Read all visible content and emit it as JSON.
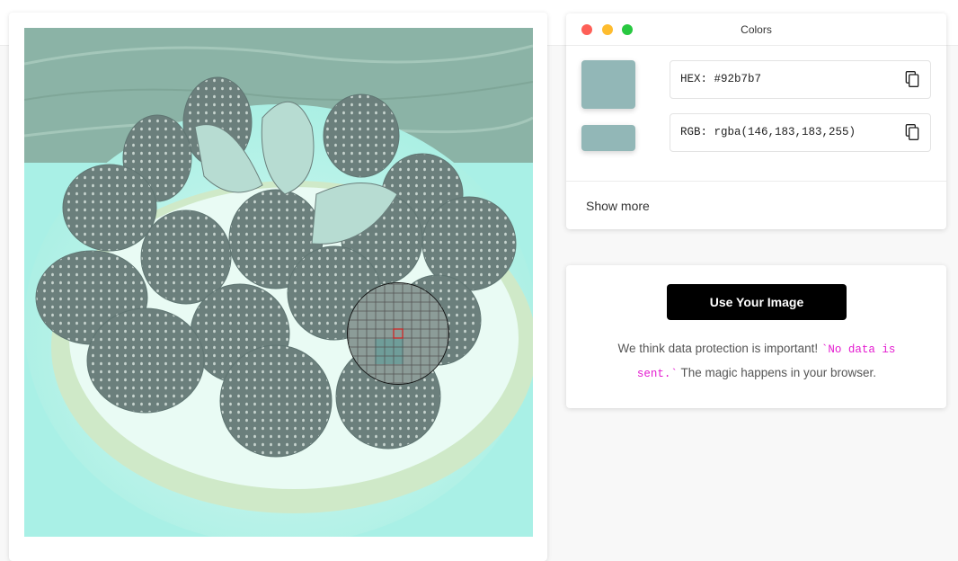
{
  "colors_panel": {
    "title": "Colors",
    "swatch_color": "#92b7b7",
    "hex_text": "HEX: #92b7b7",
    "rgb_text": "RGB: rgba(146,183,183,255)",
    "copy_icon": "copy-icon",
    "show_more_label": "Show more",
    "window_dots": [
      "#fe5f57",
      "#febc2e",
      "#28c840"
    ]
  },
  "upload_panel": {
    "button_label": "Use Your Image",
    "note_prefix": "We think data protection is important! ",
    "note_code_line1": "`No data is",
    "note_code_line2": "sent.`",
    "note_suffix": " The magic happens in your browser."
  },
  "image_panel": {
    "tint_color": "#9fe3d8"
  }
}
